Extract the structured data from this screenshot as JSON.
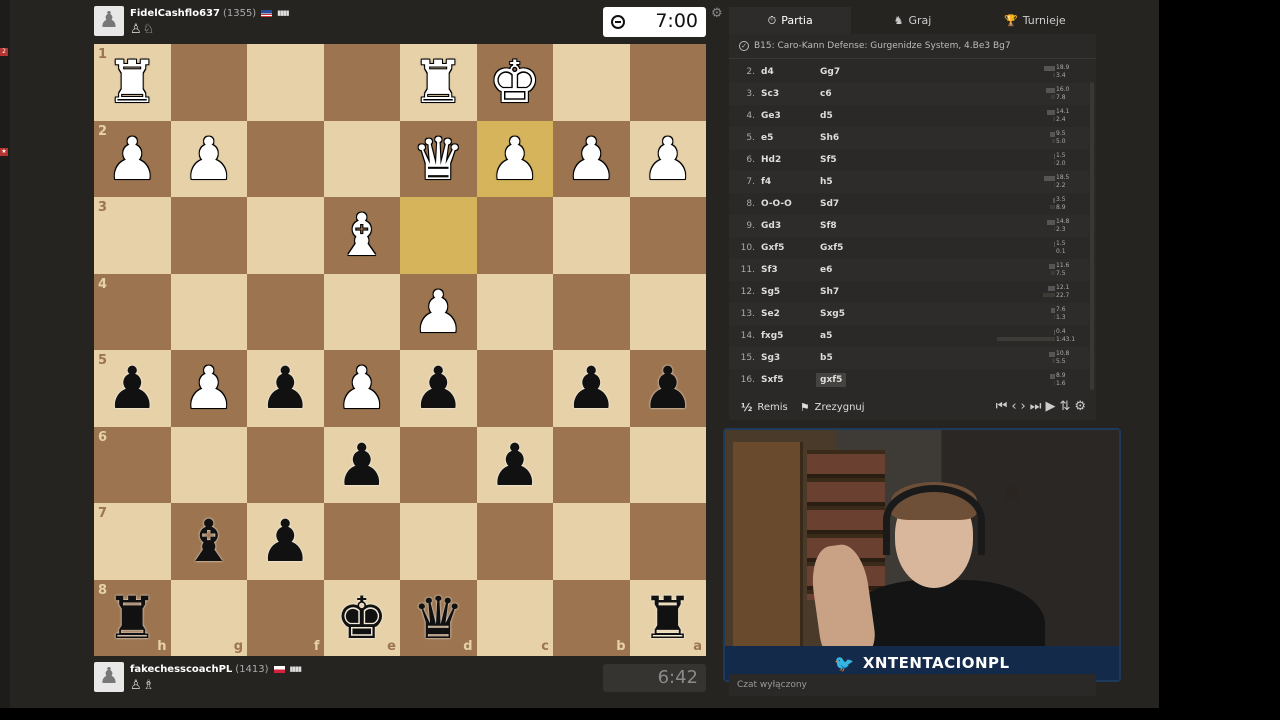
{
  "top_player": {
    "name": "FidelCashflo637",
    "rating": "(1355)",
    "captured": "♙♘",
    "clock": "7:00"
  },
  "bottom_player": {
    "name": "fakechesscoachPL",
    "rating": "(1413)",
    "captured": "♙♗",
    "clock": "6:42"
  },
  "board": {
    "rank_labels": [
      "1",
      "2",
      "3",
      "4",
      "5",
      "6",
      "7",
      "8"
    ],
    "file_labels": [
      "h",
      "g",
      "f",
      "e",
      "d",
      "c",
      "b",
      "a"
    ],
    "squares": [
      [
        "♜",
        "",
        "",
        "",
        "♜",
        "♚",
        "",
        ""
      ],
      [
        "♟",
        "♟",
        "",
        "",
        "♛",
        "♟",
        "♟",
        "♟"
      ],
      [
        "",
        "",
        "",
        "♝",
        "",
        "",
        "",
        ""
      ],
      [
        "",
        "",
        "",
        "",
        "♟",
        "",
        "",
        ""
      ],
      [
        "♟",
        "♟",
        "♟",
        "♟",
        "♟",
        "",
        "♟",
        "♟"
      ],
      [
        "",
        "",
        "",
        "♟",
        "",
        "♟",
        "",
        ""
      ],
      [
        "",
        "♝",
        "♟",
        "",
        "",
        "",
        "",
        ""
      ],
      [
        "♜",
        "",
        "",
        "♚",
        "♛",
        "",
        "",
        "♜"
      ]
    ],
    "colors": [
      [
        "w",
        "",
        "",
        "",
        "w",
        "w",
        "",
        ""
      ],
      [
        "w",
        "w",
        "",
        "",
        "w",
        "w",
        "w",
        "w"
      ],
      [
        "",
        "",
        "",
        "w",
        "",
        "",
        "",
        ""
      ],
      [
        "",
        "",
        "",
        "",
        "w",
        "",
        "",
        ""
      ],
      [
        "b",
        "w",
        "b",
        "w",
        "b",
        "",
        "b",
        "b"
      ],
      [
        "",
        "",
        "",
        "b",
        "",
        "b",
        "",
        ""
      ],
      [
        "",
        "b",
        "b",
        "",
        "",
        "",
        "",
        ""
      ],
      [
        "b",
        "",
        "",
        "b",
        "b",
        "",
        "",
        "b"
      ]
    ],
    "highlights": [
      "2-4",
      "1-5"
    ]
  },
  "panel": {
    "tabs": [
      {
        "label": "Partia",
        "icon": "stopwatch-icon",
        "glyph": "⏱"
      },
      {
        "label": "Graj",
        "icon": "play-icon",
        "glyph": "♞"
      },
      {
        "label": "Turnieje",
        "icon": "trophy-icon",
        "glyph": "🏆"
      }
    ],
    "opening": "B15: Caro-Kann Defense: Gurgenidze System, 4.Be3 Bg7",
    "moves": [
      {
        "n": "2.",
        "w": "d4",
        "b": "Gg7",
        "t1": "18.9",
        "t2": "3.4",
        "w1": 11,
        "w2": 2
      },
      {
        "n": "3.",
        "w": "Sc3",
        "b": "c6",
        "t1": "16.0",
        "t2": "7.8",
        "w1": 9,
        "w2": 4
      },
      {
        "n": "4.",
        "w": "Ge3",
        "b": "d5",
        "t1": "14.1",
        "t2": "2.4",
        "w1": 8,
        "w2": 2
      },
      {
        "n": "5.",
        "w": "e5",
        "b": "Sh6",
        "t1": "9.5",
        "t2": "5.0",
        "w1": 5,
        "w2": 3
      },
      {
        "n": "6.",
        "w": "Hd2",
        "b": "Sf5",
        "t1": "1.5",
        "t2": "2.0",
        "w1": 1,
        "w2": 1
      },
      {
        "n": "7.",
        "w": "f4",
        "b": "h5",
        "t1": "18.5",
        "t2": "2.2",
        "w1": 11,
        "w2": 1
      },
      {
        "n": "8.",
        "w": "O-O-O",
        "b": "Sd7",
        "t1": "3.5",
        "t2": "8.9",
        "w1": 2,
        "w2": 5
      },
      {
        "n": "9.",
        "w": "Gd3",
        "b": "Sf8",
        "t1": "14.8",
        "t2": "2.3",
        "w1": 8,
        "w2": 1
      },
      {
        "n": "10.",
        "w": "Gxf5",
        "b": "Gxf5",
        "t1": "1.5",
        "t2": "0.1",
        "w1": 1,
        "w2": 0
      },
      {
        "n": "11.",
        "w": "Sf3",
        "b": "e6",
        "t1": "11.6",
        "t2": "7.5",
        "w1": 6,
        "w2": 4
      },
      {
        "n": "12.",
        "w": "Sg5",
        "b": "Sh7",
        "t1": "12.1",
        "t2": "22.7",
        "w1": 7,
        "w2": 12
      },
      {
        "n": "13.",
        "w": "Se2",
        "b": "Sxg5",
        "t1": "7.6",
        "t2": "1.3",
        "w1": 4,
        "w2": 1
      },
      {
        "n": "14.",
        "w": "fxg5",
        "b": "a5",
        "t1": "0.4",
        "t2": "1:43.1",
        "w1": 1,
        "w2": 58
      },
      {
        "n": "15.",
        "w": "Sg3",
        "b": "b5",
        "t1": "10.8",
        "t2": "5.5",
        "w1": 6,
        "w2": 3
      },
      {
        "n": "16.",
        "w": "Sxf5",
        "b": "gxf5",
        "t1": "8.9",
        "t2": "1.6",
        "w1": 5,
        "w2": 1
      }
    ],
    "draw_label": "Remis",
    "draw_glyph": "½",
    "resign_label": "Zrezygnuj"
  },
  "webcam": {
    "handle": "XNTENTACIONPL"
  },
  "chat_status": "Czat wyłączony",
  "colors": {
    "light_square": "#e6d1a8",
    "dark_square": "#9c7550",
    "highlight": "#d6b45b"
  }
}
